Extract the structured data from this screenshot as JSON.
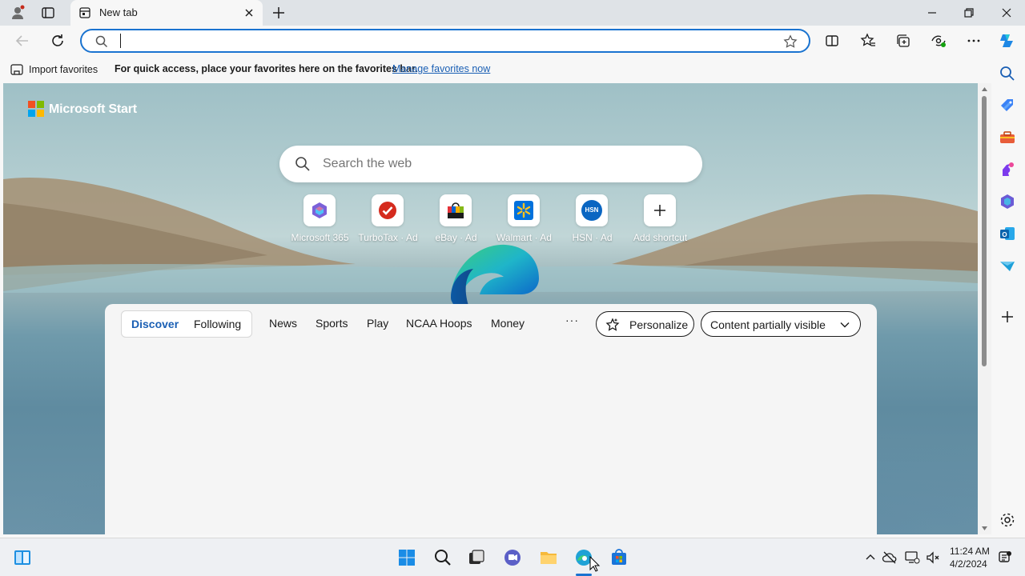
{
  "browser": {
    "tab_title": "New tab",
    "address_value": "",
    "favorites_bar": {
      "import_label": "Import favorites",
      "message": "For quick access, place your favorites here on the favorites bar.",
      "link": "Manage favorites now"
    }
  },
  "page": {
    "brand": "Microsoft Start",
    "search_placeholder": "Search the web",
    "shortcuts": [
      {
        "label": "Microsoft 365",
        "icon": "microsoft-365-icon"
      },
      {
        "label": "TurboTax · Ad",
        "icon": "turbotax-icon"
      },
      {
        "label": "eBay · Ad",
        "icon": "ebay-icon"
      },
      {
        "label": "Walmart · Ad",
        "icon": "walmart-icon"
      },
      {
        "label": "HSN · Ad",
        "icon": "hsn-icon"
      },
      {
        "label": "Add shortcut",
        "icon": "plus-icon"
      }
    ],
    "hsn_text": "HSN",
    "feed": {
      "tabs": [
        "Discover",
        "Following"
      ],
      "categories": [
        "News",
        "Sports",
        "Play",
        "NCAA Hoops",
        "Money"
      ],
      "more": "···",
      "personalize": "Personalize",
      "visibility": "Content partially visible"
    }
  },
  "taskbar": {
    "time": "11:24 AM",
    "date": "4/2/2024"
  },
  "colors": {
    "accent": "#1a5fb4",
    "address_border": "#1a73d0",
    "ms_red": "#f25022",
    "ms_green": "#7fba00",
    "ms_blue": "#00a4ef",
    "ms_yellow": "#ffb900"
  }
}
